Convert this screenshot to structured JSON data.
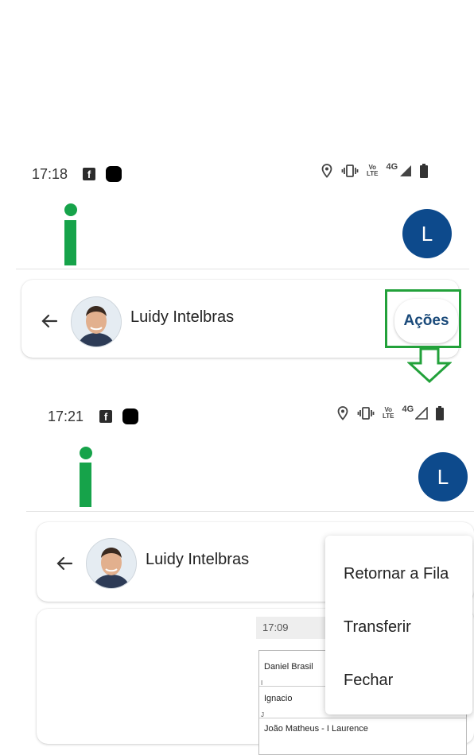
{
  "screen1": {
    "time": "17:18",
    "network": "4G",
    "volte": [
      "Vo",
      "LTE"
    ],
    "user_initial": "L",
    "contact_name": "Luidy Intelbras",
    "actions_label": "Ações"
  },
  "screen2": {
    "time": "17:21",
    "network": "4G",
    "volte": [
      "Vo",
      "LTE"
    ],
    "user_initial": "L",
    "contact_name": "Luidy Intelbras",
    "menu": [
      "Retornar a Fila",
      "Transferir",
      "Fechar"
    ],
    "message_time": "17:09",
    "list_rows": [
      "Daniel Brasil",
      "Ignacio",
      "João Matheus - I Laurence"
    ]
  },
  "colors": {
    "brand_green": "#16a34a",
    "avatar_blue": "#0d4a8c",
    "highlight_green": "#22a13a",
    "actions_text": "#1a4a7a"
  },
  "icons": [
    "facebook-icon",
    "app-icon",
    "location-icon",
    "vibrate-icon",
    "volte-icon",
    "signal-icon",
    "battery-icon",
    "back-arrow-icon"
  ]
}
